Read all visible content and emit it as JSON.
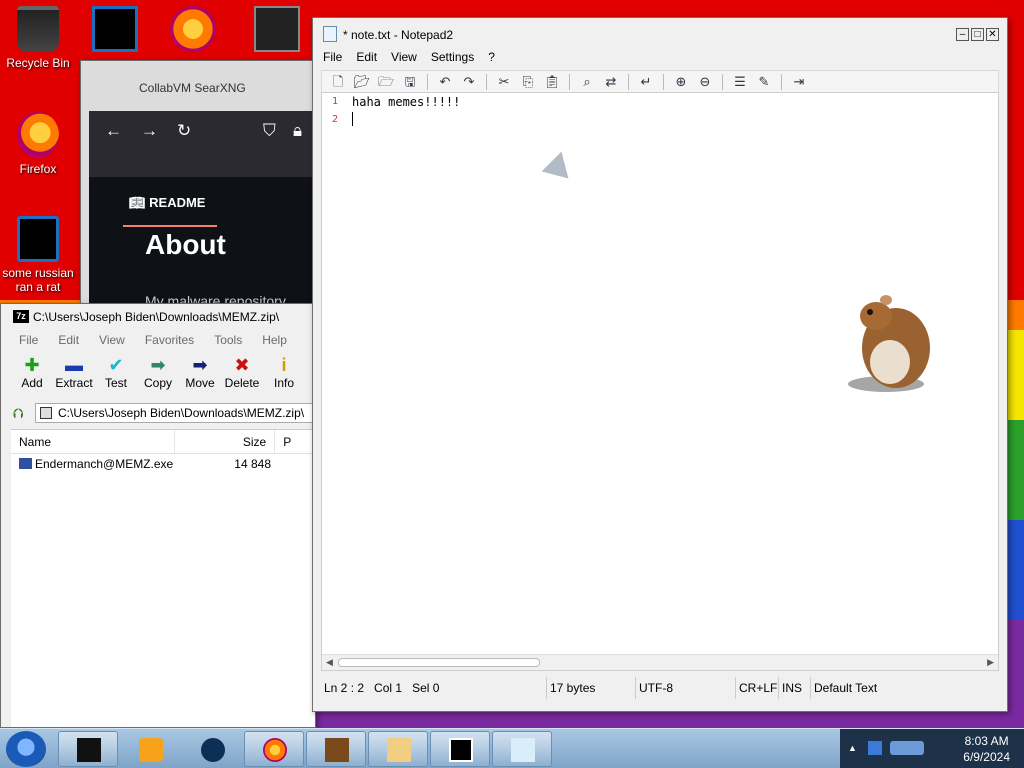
{
  "desktop": {
    "icons": [
      {
        "label": "Recycle Bin"
      },
      {
        "label": "Firefox"
      },
      {
        "label": "some russian ran a rat"
      }
    ]
  },
  "browser": {
    "title": "CollabVM SearXNG",
    "readme": "README",
    "heading": "About",
    "subtext": "My malware repository"
  },
  "zip": {
    "title": "C:\\Users\\Joseph Biden\\Downloads\\MEMZ.zip\\",
    "menu": [
      "File",
      "Edit",
      "View",
      "Favorites",
      "Tools",
      "Help"
    ],
    "toolbar": [
      {
        "label": "Add",
        "glyph": "✚",
        "color": "#1aa01a"
      },
      {
        "label": "Extract",
        "glyph": "▬",
        "color": "#1a3ab0"
      },
      {
        "label": "Test",
        "glyph": "✔",
        "color": "#19b5c8"
      },
      {
        "label": "Copy",
        "glyph": "➡",
        "color": "#2a8a6a"
      },
      {
        "label": "Move",
        "glyph": "➡",
        "color": "#16217a"
      },
      {
        "label": "Delete",
        "glyph": "✖",
        "color": "#d01010"
      },
      {
        "label": "Info",
        "glyph": "i",
        "color": "#c8a000"
      }
    ],
    "address": "C:\\Users\\Joseph Biden\\Downloads\\MEMZ.zip\\",
    "columns": [
      "Name",
      "Size",
      "P"
    ],
    "files": [
      {
        "name": "Endermanch@MEMZ.exe",
        "size": "14 848"
      }
    ]
  },
  "notepad": {
    "title": "* note.txt - Notepad2",
    "menu": [
      "File",
      "Edit",
      "View",
      "Settings",
      "?"
    ],
    "lines": [
      {
        "num": "1",
        "text": "haha memes!!!!!"
      },
      {
        "num": "2",
        "text": ""
      }
    ],
    "status": {
      "position": "Ln 2 : 2",
      "col": "Col 1",
      "sel": "Sel 0",
      "size": "17 bytes",
      "encoding": "UTF-8",
      "eol": "CR+LF",
      "mode": "INS",
      "scheme": "Default Text"
    }
  },
  "taskbar": {
    "time": "8:03 AM",
    "date": "6/9/2024"
  }
}
